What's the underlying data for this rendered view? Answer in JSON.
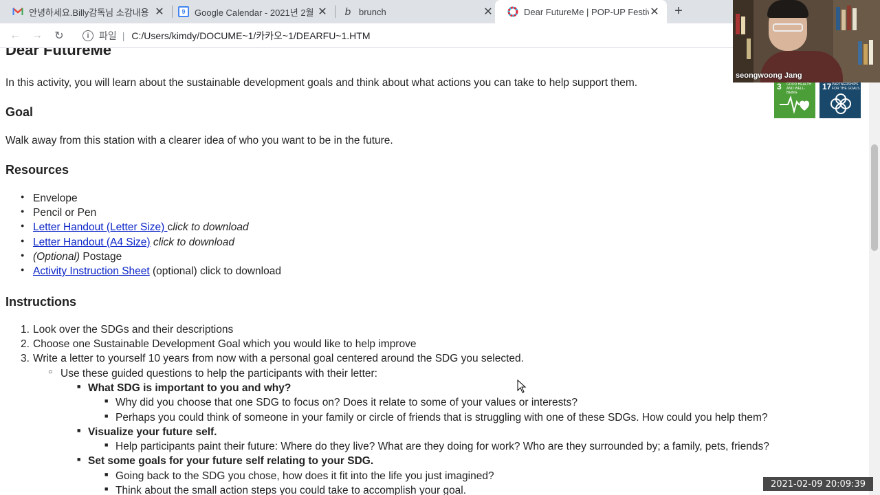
{
  "browser": {
    "tabs": [
      {
        "label": "안녕하세요.Billy감독님 소감내용",
        "icon": "gmail-icon"
      },
      {
        "label": "Google Calendar - 2021년 2월",
        "icon": "calendar-icon"
      },
      {
        "label": "brunch",
        "icon": "brunch-icon"
      },
      {
        "label": "Dear FutureMe | POP-UP Festiv",
        "icon": "sdg-icon",
        "active": true
      }
    ],
    "address": {
      "scheme_label": "파일",
      "url": "C:/Users/kimdy/DOCUME~1/카카오~1/DEARFU~1.HTM"
    }
  },
  "page": {
    "title": "Dear FutureMe",
    "intro": "In this activity, you will learn about the sustainable development goals and think about what actions you can take to help support them.",
    "goal_heading": "Goal",
    "goal_text": "Walk away from this station with a clearer idea of who you want to be in the future.",
    "resources_heading": "Resources",
    "resources": {
      "envelope": "Envelope",
      "pencil": "Pencil or Pen",
      "letter_link": "Letter Handout (Letter Size) ",
      "letter_suffix_c": "c",
      "letter_suffix": "lick to download",
      "a4_link": "Letter Handout (A4 Size)",
      "a4_suffix": " click to download",
      "postage_optional": "(Optional)",
      "postage": " Postage",
      "activity_link": "Activity Instruction Sheet",
      "activity_suffix": " (optional) click to download"
    },
    "instructions_heading": "Instructions",
    "steps": [
      "Look over the SDGs and their descriptions",
      "Choose one Sustainable Development Goal which you would like to help improve",
      "Write a letter to yourself 10 years from now with a personal goal centered around the SDG you selected."
    ],
    "guided_intro": "Use these guided questions to help the participants with their letter:",
    "q1": "What SDG is important to you and why?",
    "q1_a": "Why did you choose that one SDG to focus on? Does it relate to some of your values or interests?",
    "q1_b": "Perhaps you could think of someone in your family or circle of friends that is struggling with one of these SDGs. How could you help them?",
    "q2": "Visualize your future self.",
    "q2_a": "Help participants paint their future: Where do they live? What are they doing for work? Who are they surrounded by; a family, pets, friends?",
    "q3": "Set some goals for your future self relating to your SDG.",
    "q3_a": "Going back to the SDG you chose, how does it fit into the life you just imagined?",
    "q3_b": "Think about the small action steps you could take to accomplish your goal."
  },
  "sdg_tiles": [
    {
      "number": "3",
      "caption": "GOOD HEALTH AND WELL-BEING",
      "color": "#4c9f38"
    },
    {
      "number": "17",
      "caption": "PARTNERSHIPS FOR THE GOALS",
      "color": "#19486a"
    }
  ],
  "video": {
    "participant_name": "seongwoong Jang"
  },
  "timestamp": "2021-02-09  20:09:39"
}
